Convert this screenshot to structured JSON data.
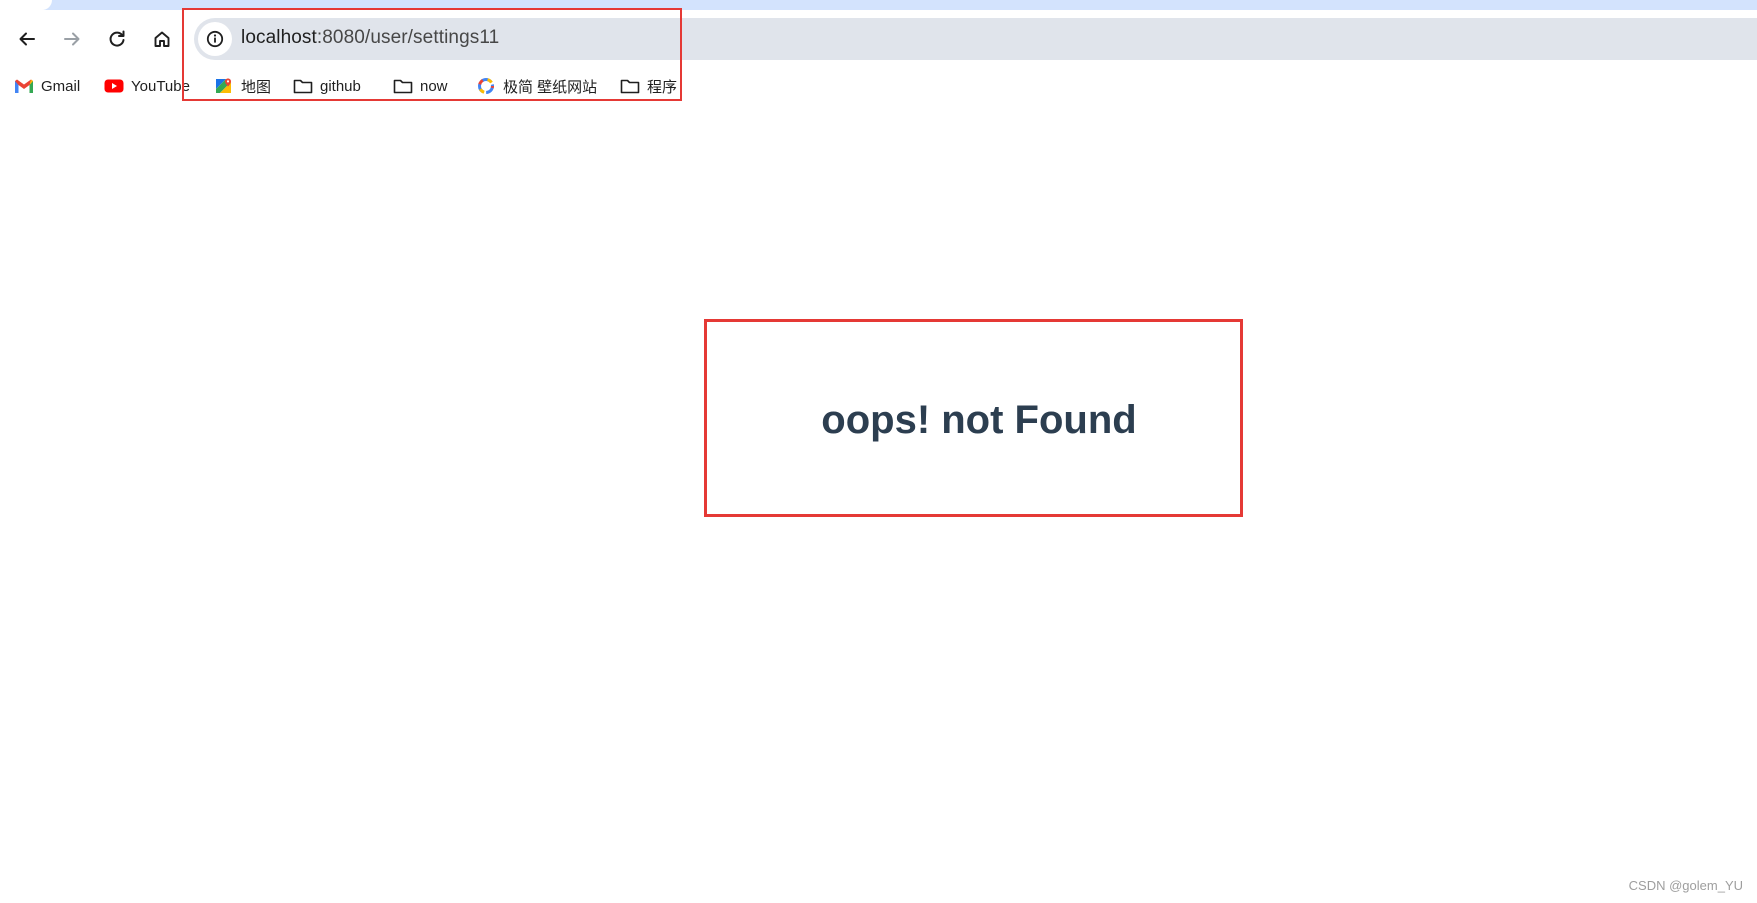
{
  "browser": {
    "nav": {
      "back_icon": "arrow-left-icon",
      "forward_icon": "arrow-right-icon",
      "reload_icon": "reload-icon",
      "home_icon": "home-icon"
    },
    "omnibox": {
      "site_info_icon": "info-circle-icon",
      "url_host": "localhost",
      "url_path": ":8080/user/settings11"
    },
    "bookmarks": [
      {
        "label": "Gmail",
        "icon": "gmail-icon"
      },
      {
        "label": "YouTube",
        "icon": "youtube-icon"
      },
      {
        "label": "地图",
        "icon": "maps-icon"
      },
      {
        "label": "github",
        "icon": "folder-icon"
      },
      {
        "label": "now",
        "icon": "folder-icon"
      },
      {
        "label": "极简 壁纸网站",
        "icon": "wallpaper-site-icon"
      },
      {
        "label": "程序",
        "icon": "folder-icon"
      }
    ]
  },
  "page": {
    "message": "oops! not Found"
  },
  "watermark": "CSDN @golem_YU",
  "colors": {
    "highlight": "#e53935",
    "message_text": "#2c3e50",
    "omnibox_bg": "#e0e4eb",
    "tabstrip_bg": "#d3e3fd"
  }
}
